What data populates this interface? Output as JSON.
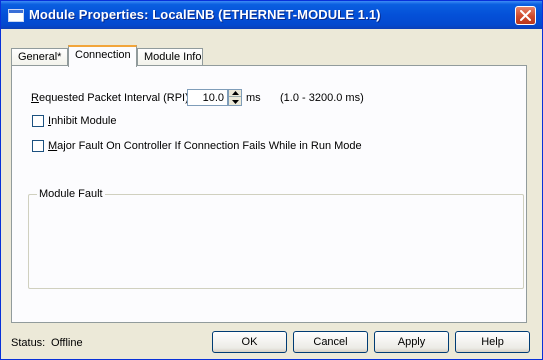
{
  "window": {
    "title": "Module Properties: LocalENB (ETHERNET-MODULE 1.1)",
    "close_icon": "close-icon",
    "app_icon": "module-window-icon"
  },
  "tabs": [
    {
      "label": "General*",
      "active": false
    },
    {
      "label": "Connection",
      "active": true
    },
    {
      "label": "Module Info",
      "active": false
    }
  ],
  "connection": {
    "rpi_label_underlined": "R",
    "rpi_label_rest": "equested Packet Interval (RPI):",
    "rpi_value": "10.0",
    "rpi_units": "ms",
    "rpi_range": "(1.0 - 3200.0 ms)",
    "inhibit_underlined": "I",
    "inhibit_rest": "nhibit Module",
    "inhibit_checked": false,
    "major_fault_underlined": "M",
    "major_fault_rest": "ajor Fault On Controller If Connection Fails While in Run Mode",
    "major_fault_checked": false,
    "module_fault_label": "Module Fault"
  },
  "status": {
    "label": "Status:",
    "value": "Offline"
  },
  "buttons": {
    "ok": "OK",
    "cancel": "Cancel",
    "apply": "Apply",
    "help": "Help"
  },
  "colors": {
    "titlebar": "#0450d8",
    "close_button": "#cf4a2b",
    "active_tab_accent": "#f2a53a",
    "dialog_background": "#ece9d8"
  }
}
